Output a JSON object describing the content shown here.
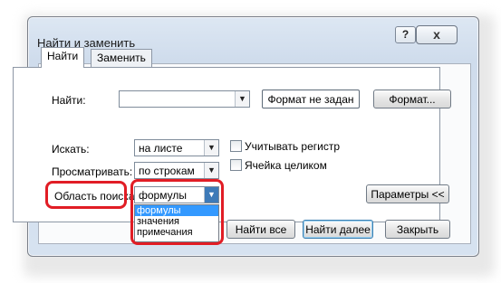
{
  "window": {
    "title": "Найти и заменить"
  },
  "title_bar": {
    "help": "?",
    "close": "x"
  },
  "tabs": [
    {
      "label": "Найти",
      "active": true
    },
    {
      "label": "Заменить",
      "active": false
    }
  ],
  "find": {
    "label": "Найти:",
    "value": "",
    "format_status": "Формат не задан",
    "format_button": "Формат..."
  },
  "options": {
    "within_label": "Искать:",
    "within_value": "на листе",
    "search_label": "Просматривать:",
    "search_value": "по строкам",
    "look_in_label": "Область поиска:",
    "look_in_value": "формулы",
    "look_in_options": [
      "формулы",
      "значения",
      "примечания"
    ],
    "match_case": "Учитывать регистр",
    "match_entire": "Ячейка целиком",
    "params_button": "Параметры <<"
  },
  "buttons": {
    "find_all": "Найти все",
    "find_next": "Найти далее",
    "close": "Закрыть"
  },
  "highlight_color": "#e11d25"
}
